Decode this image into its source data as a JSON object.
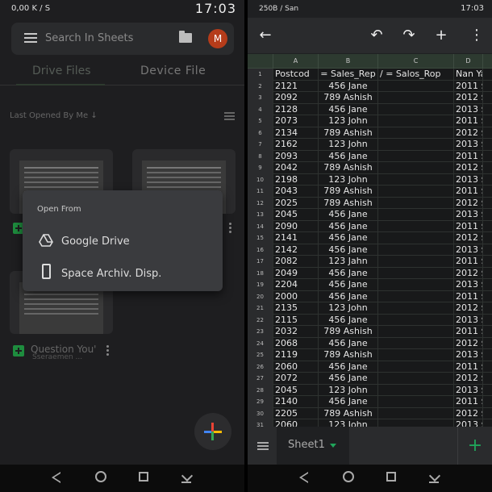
{
  "left": {
    "status": {
      "left": "0,00 K / S",
      "time": "17:03"
    },
    "search": {
      "placeholder": "Search In Sheets",
      "avatar": "M"
    },
    "tabs": [
      {
        "label": "Drive Files"
      },
      {
        "label": "Device File"
      }
    ],
    "sort_label": "Last Opened By Me",
    "cards": [
      {
        "title": "",
        "sub": ""
      },
      {
        "title": "",
        "sub": ""
      },
      {
        "title": "Question You'",
        "sub": "Sseraemen ..."
      }
    ],
    "popup": {
      "header": "Open From",
      "items": [
        {
          "label": "Google Drive",
          "icon": "google-drive-icon"
        },
        {
          "label": "Space Archiv. Disp.",
          "icon": "phone-icon"
        }
      ]
    }
  },
  "right": {
    "status": {
      "left": "250B / San",
      "time": "17:03"
    },
    "columns": [
      "A",
      "B",
      "C",
      "D",
      ""
    ],
    "rows": [
      {
        "n": "1",
        "a": "Postcod",
        "b": "= Sales_Rep",
        "c": "/ = Salos_Rop",
        "d": "Nan Ya V"
      },
      {
        "n": "2",
        "a": "2121",
        "b": "456 Jane",
        "c": "",
        "d": "2011 $:"
      },
      {
        "n": "3",
        "a": "2092",
        "b": "789 Ashish",
        "c": "",
        "d": "2012 $:"
      },
      {
        "n": "4",
        "a": "2128",
        "b": "456 Jane",
        "c": "",
        "d": "2013 $"
      },
      {
        "n": "5",
        "a": "2073",
        "b": "123 John",
        "c": "",
        "d": "2011 $"
      },
      {
        "n": "6",
        "a": "2134",
        "b": "789 Ashish",
        "c": "",
        "d": "2012 $"
      },
      {
        "n": "7",
        "a": "2162",
        "b": "123 John",
        "c": "",
        "d": "2013 $1"
      },
      {
        "n": "8",
        "a": "2093",
        "b": "456 Jane",
        "c": "",
        "d": "2011 $:"
      },
      {
        "n": "9",
        "a": "2042",
        "b": "789 Ashish",
        "c": "",
        "d": "2012 $"
      },
      {
        "n": "10",
        "a": "2198",
        "b": "123 John",
        "c": "",
        "d": "2013 $"
      },
      {
        "n": "11",
        "a": "2043",
        "b": "789 Ashish",
        "c": "",
        "d": "2011 $"
      },
      {
        "n": "12",
        "a": "2025",
        "b": "789 Ashish",
        "c": "",
        "d": "2012 $"
      },
      {
        "n": "13",
        "a": "2045",
        "b": "456 Jane",
        "c": "",
        "d": "2013 $"
      },
      {
        "n": "14",
        "a": "2090",
        "b": "456 Jane",
        "c": "",
        "d": "2011 $"
      },
      {
        "n": "15",
        "a": "2141",
        "b": "456 Jane",
        "c": "",
        "d": "2012 $"
      },
      {
        "n": "16",
        "a": "2142",
        "b": "456 Jane",
        "c": "",
        "d": "2013 $:"
      },
      {
        "n": "17",
        "a": "2082",
        "b": "123 Jahn",
        "c": "",
        "d": "2011 $"
      },
      {
        "n": "18",
        "a": "2049",
        "b": "456 Jane",
        "c": "",
        "d": "2012 $"
      },
      {
        "n": "19",
        "a": "2204",
        "b": "456 Jane",
        "c": "",
        "d": "2013 $"
      },
      {
        "n": "20",
        "a": "2000",
        "b": "456 Jane",
        "c": "",
        "d": "2011 $"
      },
      {
        "n": "21",
        "a": "2135",
        "b": "123 John",
        "c": "",
        "d": "2012 $"
      },
      {
        "n": "22",
        "a": "2115",
        "b": "456 Jane",
        "c": "",
        "d": "2013 $"
      },
      {
        "n": "23",
        "a": "2032",
        "b": "789 Ashish",
        "c": "",
        "d": "2011 $"
      },
      {
        "n": "24",
        "a": "2068",
        "b": "456 Jane",
        "c": "",
        "d": "2012 $"
      },
      {
        "n": "25",
        "a": "2119",
        "b": "789 Ashish",
        "c": "",
        "d": "2013 $"
      },
      {
        "n": "26",
        "a": "2060",
        "b": "456 Jane",
        "c": "",
        "d": "2011 $"
      },
      {
        "n": "27",
        "a": "2072",
        "b": "456 Jane",
        "c": "",
        "d": "2012 $"
      },
      {
        "n": "28",
        "a": "2045",
        "b": "123 John",
        "c": "",
        "d": "2013 $"
      },
      {
        "n": "29",
        "a": "2140",
        "b": "456 Jane",
        "c": "",
        "d": "2011 $"
      },
      {
        "n": "30",
        "a": "2205",
        "b": "789 Ashish",
        "c": "",
        "d": "2012 $"
      },
      {
        "n": "31",
        "a": "2060",
        "b": "123 John",
        "c": "",
        "d": "2013 $"
      }
    ],
    "sheet_tab": "Sheet1"
  }
}
